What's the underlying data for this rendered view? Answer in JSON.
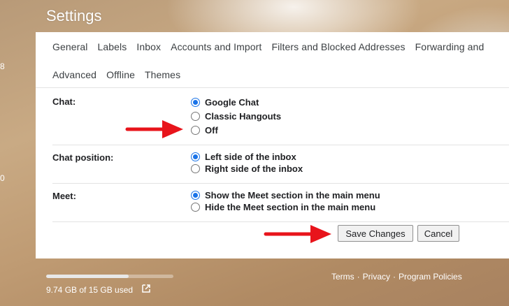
{
  "page": {
    "title": "Settings"
  },
  "edge_text": [
    "8",
    "0"
  ],
  "tabs": {
    "row1": [
      "General",
      "Labels",
      "Inbox",
      "Accounts and Import",
      "Filters and Blocked Addresses",
      "Forwarding and"
    ],
    "row2": [
      "Advanced",
      "Offline",
      "Themes"
    ]
  },
  "sections": {
    "chat": {
      "label": "Chat:",
      "options": [
        "Google Chat",
        "Classic Hangouts",
        "Off"
      ],
      "selected": "Google Chat"
    },
    "chat_position": {
      "label": "Chat position:",
      "options": [
        "Left side of the inbox",
        "Right side of the inbox"
      ],
      "selected": "Left side of the inbox"
    },
    "meet": {
      "label": "Meet:",
      "options": [
        "Show the Meet section in the main menu",
        "Hide the Meet section in the main menu"
      ],
      "selected": "Show the Meet section in the main menu"
    }
  },
  "actions": {
    "save_label": "Save Changes",
    "cancel_label": "Cancel"
  },
  "storage": {
    "text": "9.74 GB of 15 GB used",
    "fraction_used": 0.65
  },
  "footer": {
    "terms": "Terms",
    "sep": "·",
    "privacy": "Privacy",
    "policies": "Program Policies"
  },
  "colors": {
    "accent": "#1a73e8",
    "annotation_arrow": "#e8141b"
  },
  "icons": {
    "external_link": "external-link-icon",
    "arrow": "arrow-annotation-icon"
  }
}
